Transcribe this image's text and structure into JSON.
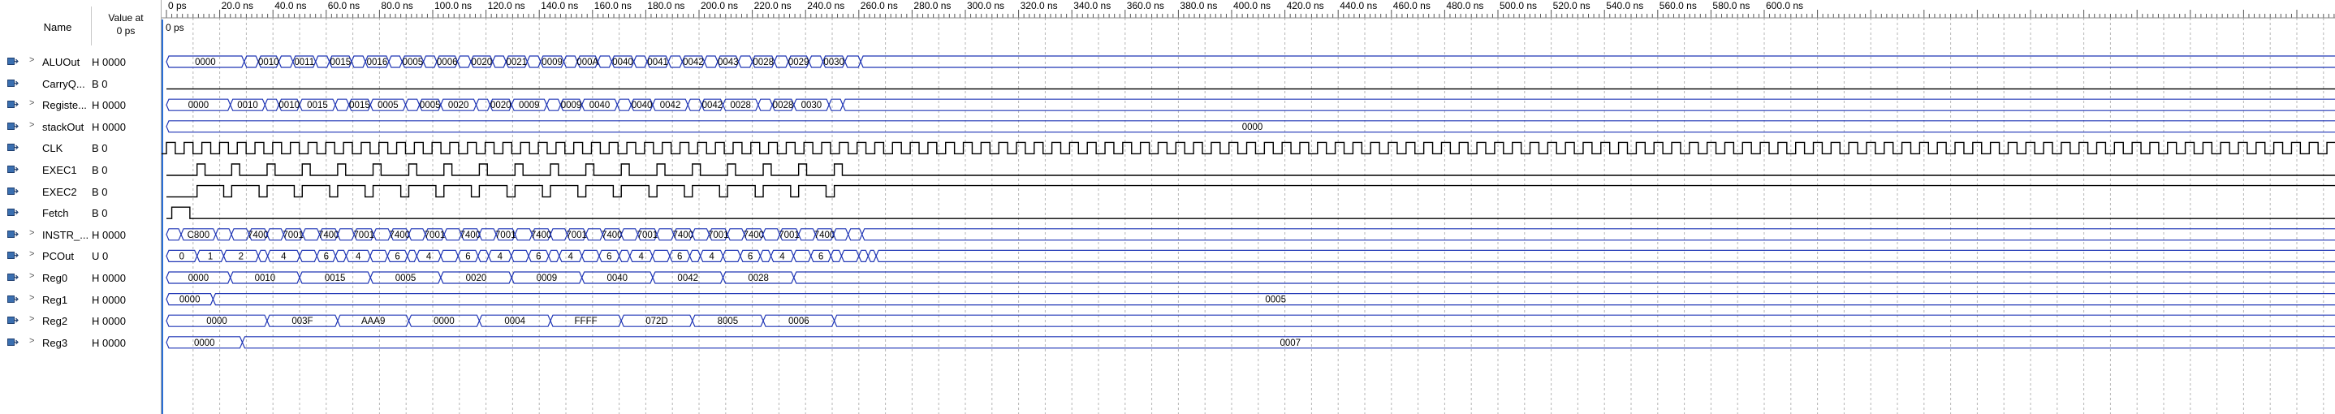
{
  "columns": {
    "name": "Name",
    "value_line1": "Value at",
    "value_line2": "0 ps"
  },
  "cursor_label": "0 ps",
  "time_labels": [
    "0 ps",
    "20.0 ns",
    "40.0 ns",
    "60.0 ns",
    "80.0 ns",
    "100.0 ns",
    "120.0 ns",
    "140.0 ns",
    "160.0 ns",
    "180.0 ns",
    "200.0 ns",
    "220.0 ns",
    "240.0 ns",
    "260.0 ns",
    "280.0 ns",
    "300.0 ns",
    "320.0 ns",
    "340.0 ns",
    "360.0 ns",
    "380.0 ns",
    "400.0 ns",
    "420.0 ns",
    "440.0 ns",
    "460.0 ns",
    "480.0 ns",
    "500.0 ns",
    "520.0 ns",
    "540.0 ns",
    "560.0 ns",
    "580.0 ns",
    "600.0 ns"
  ],
  "signals": [
    {
      "name": "ALUOut",
      "value": "H 0000",
      "type": "bus",
      "expandable": true,
      "icon": "output-icon",
      "segments": [
        [
          0,
          "0000"
        ],
        [
          29.2,
          "0020"
        ],
        [
          34.5,
          "0010"
        ],
        [
          42.2,
          "0015"
        ],
        [
          47.5,
          "0011"
        ],
        [
          56,
          "002A"
        ],
        [
          61.2,
          "0015"
        ],
        [
          69.5,
          "001A"
        ],
        [
          74.7,
          "0016"
        ],
        [
          83.5,
          "000A"
        ],
        [
          88.5,
          "0005"
        ],
        [
          96.5,
          "000A"
        ],
        [
          101.5,
          "0006"
        ],
        [
          109.3,
          "0040"
        ],
        [
          114.3,
          "0020"
        ],
        [
          122.5,
          "0025"
        ],
        [
          127.5,
          "0021"
        ],
        [
          135.5,
          "0012"
        ],
        [
          140.5,
          "0009"
        ],
        [
          149.2,
          "000E"
        ],
        [
          154.3,
          "000A"
        ],
        [
          162,
          "0080"
        ],
        [
          167.2,
          "0040"
        ],
        [
          175.5,
          "0045"
        ],
        [
          180.5,
          "0041"
        ],
        [
          188.5,
          "0084"
        ],
        [
          193.7,
          "0042"
        ],
        [
          202,
          "0047"
        ],
        [
          207,
          "0043"
        ],
        [
          214.8,
          "0050"
        ],
        [
          220,
          "0028"
        ],
        [
          228.3,
          "002D"
        ],
        [
          233.5,
          "0029"
        ],
        [
          241.3,
          "0060"
        ],
        [
          246.5,
          "0030"
        ],
        [
          254.8,
          "0035"
        ],
        [
          260.7,
          ""
        ]
      ]
    },
    {
      "name": "CarryQ...",
      "value": "B 0",
      "type": "bit",
      "expandable": false,
      "icon": "output-icon",
      "edges": [
        0
      ],
      "init": 0
    },
    {
      "name": "Registe...",
      "value": "H 0000",
      "type": "bus",
      "expandable": true,
      "icon": "output-icon",
      "segments": [
        [
          0,
          "0000"
        ],
        [
          24,
          "0010"
        ],
        [
          37,
          "0007"
        ],
        [
          42.2,
          "0010"
        ],
        [
          50,
          "0015"
        ],
        [
          63.4,
          "0007"
        ],
        [
          68.5,
          "0015"
        ],
        [
          76.6,
          "0005"
        ],
        [
          89.8,
          "0007"
        ],
        [
          95,
          "0005"
        ],
        [
          103,
          "0020"
        ],
        [
          116.3,
          "0007"
        ],
        [
          121.5,
          "0020"
        ],
        [
          129.6,
          "0009"
        ],
        [
          142.8,
          "0007"
        ],
        [
          148,
          "0009"
        ],
        [
          156,
          "0040"
        ],
        [
          169.3,
          "0007"
        ],
        [
          174.5,
          "0040"
        ],
        [
          182.6,
          "0042"
        ],
        [
          195.8,
          "0007"
        ],
        [
          201,
          "0042"
        ],
        [
          209,
          "0028"
        ],
        [
          222.2,
          "0007"
        ],
        [
          227.5,
          "0028"
        ],
        [
          235.6,
          "0030"
        ],
        [
          248.8,
          "0007"
        ],
        [
          254,
          ""
        ]
      ]
    },
    {
      "name": "stackOut",
      "value": "H 0000",
      "type": "bus",
      "expandable": true,
      "icon": "output-icon",
      "segments": [
        [
          0,
          "0000"
        ]
      ]
    },
    {
      "name": "CLK",
      "value": "B 0",
      "type": "clock",
      "expandable": false,
      "icon": "input-icon",
      "period": 6.65
    },
    {
      "name": "EXEC1",
      "value": "B 0",
      "type": "bit",
      "expandable": false,
      "icon": "output-icon",
      "init": 0,
      "edges": [
        11.5,
        14.5,
        24.5,
        27.5,
        37.8,
        40.8,
        51,
        54,
        64.3,
        67.3,
        77.6,
        80.6,
        91,
        94,
        104.2,
        107.2,
        117.5,
        120.5,
        130.9,
        133.9,
        144.2,
        147.2,
        157.5,
        160.5,
        170.8,
        173.8,
        184.2,
        187.2,
        197.5,
        200.5,
        210.7,
        213.7,
        224.1,
        227.1,
        237.4,
        240.4,
        250.8,
        253.8
      ]
    },
    {
      "name": "EXEC2",
      "value": "B 0",
      "type": "bit",
      "expandable": false,
      "icon": "output-icon",
      "init": 0,
      "edges": [
        11.5,
        21.5,
        24.5,
        34.8,
        37.8,
        48,
        51,
        61.3,
        64.3,
        74.6,
        77.6,
        88,
        91,
        101.2,
        104.2,
        114.5,
        117.5,
        127.9,
        130.9,
        141.2,
        144.2,
        154.5,
        157.5,
        167.8,
        170.8,
        181.2,
        184.2,
        194.5,
        197.5,
        207.7,
        210.7,
        221.1,
        224.1,
        234.4,
        237.4,
        247.7,
        250.8
      ]
    },
    {
      "name": "Fetch",
      "value": "B 0",
      "type": "bit",
      "expandable": false,
      "icon": "output-icon",
      "init": 0,
      "edges": [
        2,
        8.8
      ]
    },
    {
      "name": "INSTR_...",
      "value": "H 0000",
      "type": "bus",
      "expandable": true,
      "icon": "output-icon",
      "segments": [
        [
          0,
          "0000"
        ],
        [
          5.5,
          "C800"
        ],
        [
          18.5,
          "C001"
        ],
        [
          24.4,
          "9807"
        ],
        [
          31,
          "7400"
        ],
        [
          37.8,
          "E227"
        ],
        [
          44,
          "7001"
        ],
        [
          51.2,
          "F803"
        ],
        [
          57.5,
          "7400"
        ],
        [
          64.3,
          "E227"
        ],
        [
          70.5,
          "7001"
        ],
        [
          77.8,
          "F803"
        ],
        [
          84.2,
          "7400"
        ],
        [
          91,
          "E227"
        ],
        [
          97.2,
          "7001"
        ],
        [
          104.3,
          "F803"
        ],
        [
          110.7,
          "7400"
        ],
        [
          117.5,
          "E227"
        ],
        [
          123.8,
          "7001"
        ],
        [
          130.9,
          "F803"
        ],
        [
          137.3,
          "7400"
        ],
        [
          144.2,
          "E227"
        ],
        [
          150.5,
          "7001"
        ],
        [
          157.5,
          "F803"
        ],
        [
          163.8,
          "7400"
        ],
        [
          170.8,
          "E227"
        ],
        [
          177,
          "7001"
        ],
        [
          184.2,
          "F803"
        ],
        [
          190.5,
          "7400"
        ],
        [
          197.5,
          "E227"
        ],
        [
          203.8,
          "7001"
        ],
        [
          210.7,
          "F803"
        ],
        [
          217,
          "7400"
        ],
        [
          224,
          "E227"
        ],
        [
          230.3,
          "7001"
        ],
        [
          237.4,
          "F803"
        ],
        [
          243.7,
          "7400"
        ],
        [
          250.5,
          "E227"
        ],
        [
          256,
          "A001"
        ],
        [
          261.2,
          ""
        ]
      ]
    },
    {
      "name": "PCOut",
      "value": "U 0",
      "type": "bus",
      "expandable": true,
      "icon": "output-icon",
      "segments": [
        [
          0,
          "0"
        ],
        [
          11.5,
          "1"
        ],
        [
          21.5,
          "2"
        ],
        [
          34.5,
          "3"
        ],
        [
          38,
          "4"
        ],
        [
          50,
          "5"
        ],
        [
          56.5,
          "6"
        ],
        [
          63.5,
          "7"
        ],
        [
          67.5,
          "4"
        ],
        [
          76.5,
          "5"
        ],
        [
          83,
          "6"
        ],
        [
          90.5,
          "7"
        ],
        [
          94,
          "4"
        ],
        [
          103,
          "5"
        ],
        [
          109.5,
          "6"
        ],
        [
          117,
          "7"
        ],
        [
          121,
          "4"
        ],
        [
          129.5,
          "5"
        ],
        [
          136,
          "6"
        ],
        [
          143.5,
          "7"
        ],
        [
          147.5,
          "4"
        ],
        [
          156,
          "5"
        ],
        [
          162.5,
          "6"
        ],
        [
          170,
          "7"
        ],
        [
          174,
          "4"
        ],
        [
          182.5,
          "5"
        ],
        [
          189,
          "6"
        ],
        [
          196.5,
          "7"
        ],
        [
          200.5,
          "4"
        ],
        [
          209,
          "5"
        ],
        [
          215.5,
          "6"
        ],
        [
          223,
          "7"
        ],
        [
          227,
          "4"
        ],
        [
          235.5,
          "5"
        ],
        [
          242,
          "6"
        ],
        [
          249.5,
          "7"
        ],
        [
          253.5,
          "4"
        ],
        [
          260,
          "5"
        ],
        [
          263.5,
          "8"
        ],
        [
          266.5,
          ""
        ]
      ]
    },
    {
      "name": "Reg0",
      "value": "H 0000",
      "type": "bus",
      "expandable": true,
      "icon": "output-icon",
      "segments": [
        [
          0,
          "0000"
        ],
        [
          24,
          "0010"
        ],
        [
          50,
          "0015"
        ],
        [
          76.6,
          "0005"
        ],
        [
          103,
          "0020"
        ],
        [
          129.6,
          "0009"
        ],
        [
          156,
          "0040"
        ],
        [
          182.6,
          "0042"
        ],
        [
          209,
          "0028"
        ],
        [
          235.6,
          ""
        ]
      ]
    },
    {
      "name": "Reg1",
      "value": "H 0000",
      "type": "bus",
      "expandable": true,
      "icon": "output-icon",
      "segments": [
        [
          0,
          "0000"
        ],
        [
          17.5,
          "0005"
        ]
      ]
    },
    {
      "name": "Reg2",
      "value": "H 0000",
      "type": "bus",
      "expandable": true,
      "icon": "output-icon",
      "segments": [
        [
          0,
          "0000"
        ],
        [
          37.8,
          "003F"
        ],
        [
          64.3,
          "AAA9"
        ],
        [
          91,
          "0000"
        ],
        [
          117.5,
          "0004"
        ],
        [
          144.2,
          "FFFF"
        ],
        [
          170.8,
          "072D"
        ],
        [
          197.5,
          "8005"
        ],
        [
          224.1,
          "0006"
        ],
        [
          250.8,
          ""
        ]
      ]
    },
    {
      "name": "Reg3",
      "value": "H 0000",
      "type": "bus",
      "expandable": true,
      "icon": "output-icon",
      "segments": [
        [
          0,
          "0000"
        ],
        [
          28.5,
          "0007"
        ]
      ]
    }
  ]
}
